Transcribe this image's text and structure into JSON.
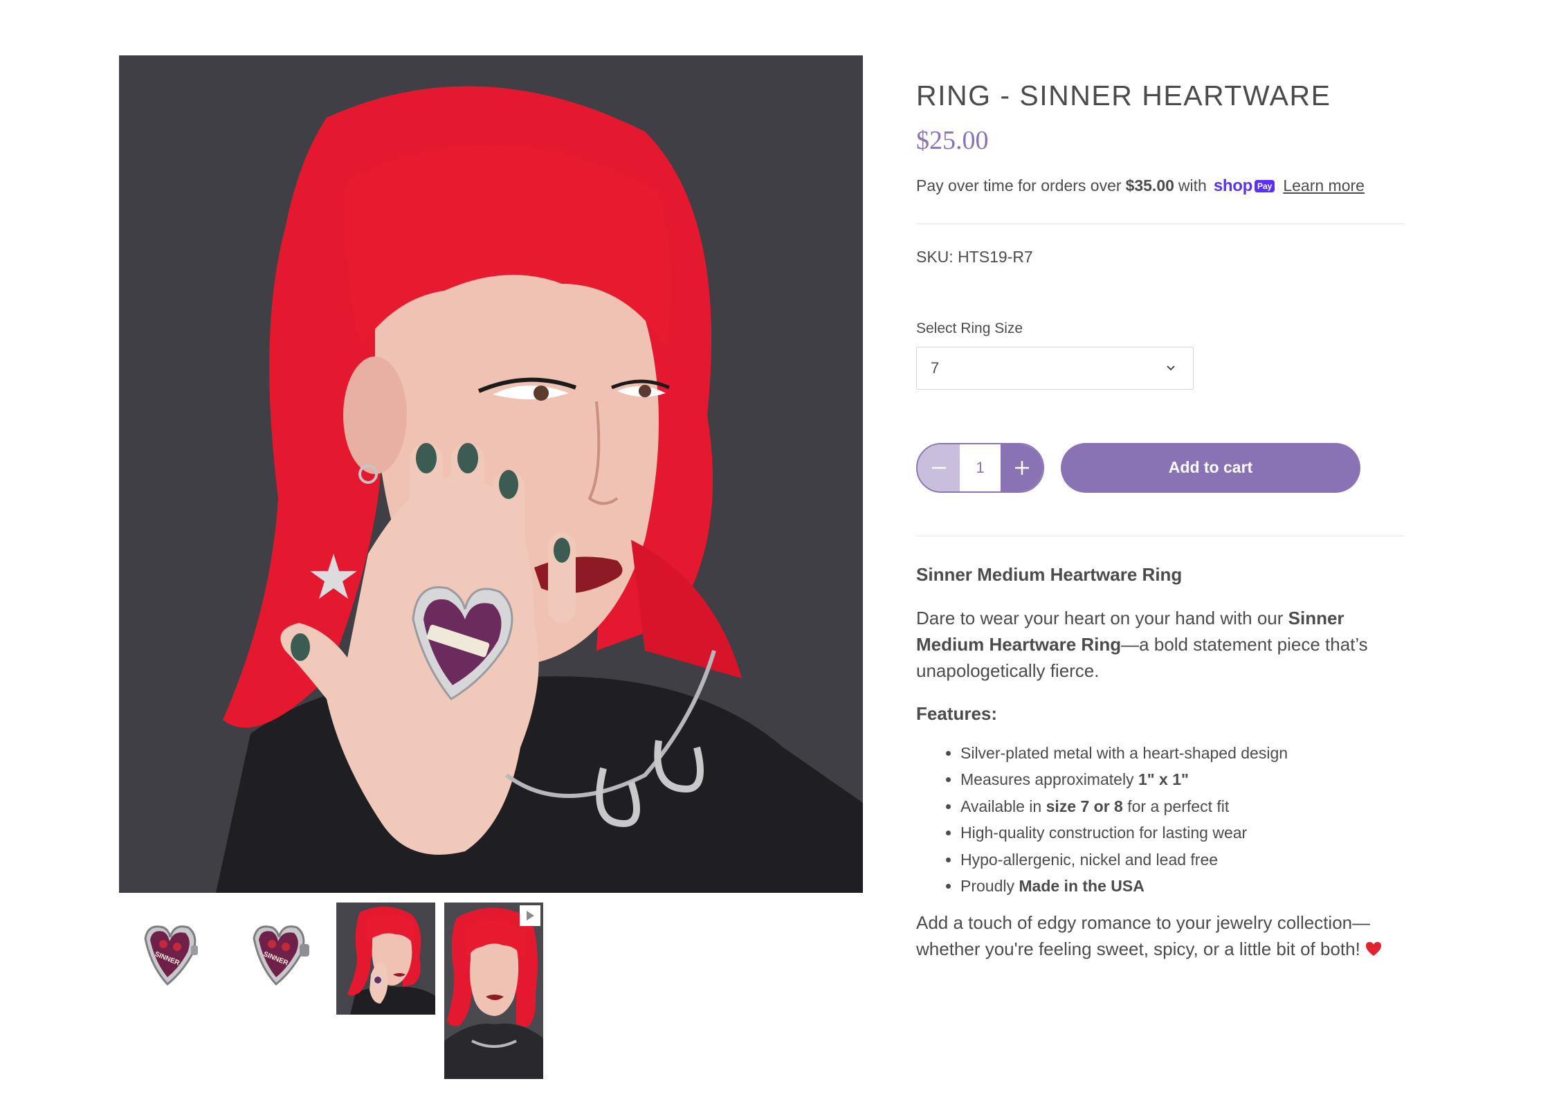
{
  "product": {
    "title": "RING - SINNER HEARTWARE",
    "price": "$25.00",
    "installments": {
      "text_before": "Pay over time for orders over",
      "threshold": "$35.00",
      "text_with": "with",
      "provider": "shop",
      "provider_badge": "Pay",
      "learn_more": "Learn more"
    },
    "sku": "SKU: HTS19-R7",
    "size_label": "Select Ring Size",
    "size_value": "7",
    "quantity": "1",
    "add_to_cart": "Add to cart"
  },
  "media": {
    "ring_thumb_text": "SINNER"
  },
  "description": {
    "heading": "Sinner Medium Heartware Ring",
    "intro_before": "Dare to wear your heart on your hand with our ",
    "intro_bold": "Sinner Medium Heartware Ring",
    "intro_after": "—a bold statement piece that’s unapologetically fierce.",
    "features_heading": "Features:",
    "features": [
      {
        "before": "Silver-plated metal with a heart-shaped design",
        "bold": "",
        "after": ""
      },
      {
        "before": "Measures approximately ",
        "bold": "1\" x 1\"",
        "after": ""
      },
      {
        "before": "Available in ",
        "bold": "size 7 or 8",
        "after": " for a perfect fit"
      },
      {
        "before": "High-quality construction for lasting wear",
        "bold": "",
        "after": ""
      },
      {
        "before": "Hypo-allergenic, nickel and lead free",
        "bold": "",
        "after": ""
      },
      {
        "before": "Proudly ",
        "bold": "Made in the USA",
        "after": ""
      }
    ],
    "closing": "Add a touch of edgy romance to your jewelry collection—whether you're feeling sweet, spicy, or a little bit of both!"
  },
  "colors": {
    "accent": "#8a73b5",
    "accent_light": "#c9bfdc",
    "shop_pay": "#5a31f4",
    "text": "#4b4b4b"
  },
  "icons": [
    "chevron-down-icon",
    "minus-icon",
    "plus-icon",
    "play-icon",
    "heart-emoji-icon"
  ]
}
